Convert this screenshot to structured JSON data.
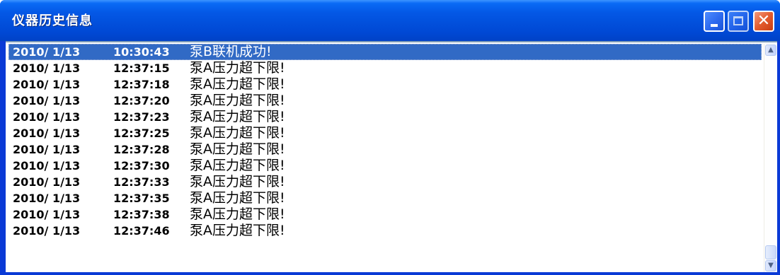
{
  "window": {
    "title": "仪器历史信息",
    "controls": {
      "minimize": "minimize",
      "maximize": "maximize",
      "close": "✕"
    }
  },
  "colors": {
    "titlebar": "#0458e6",
    "selection": "#316ac5",
    "close_button": "#e35b2e"
  },
  "log": {
    "selected_index": 0,
    "entries": [
      {
        "date": "2010/ 1/13",
        "time": "10:30:43",
        "message": "泵B联机成功!"
      },
      {
        "date": "2010/ 1/13",
        "time": "12:37:15",
        "message": "泵A压力超下限!"
      },
      {
        "date": "2010/ 1/13",
        "time": "12:37:18",
        "message": "泵A压力超下限!"
      },
      {
        "date": "2010/ 1/13",
        "time": "12:37:20",
        "message": "泵A压力超下限!"
      },
      {
        "date": "2010/ 1/13",
        "time": "12:37:23",
        "message": "泵A压力超下限!"
      },
      {
        "date": "2010/ 1/13",
        "time": "12:37:25",
        "message": "泵A压力超下限!"
      },
      {
        "date": "2010/ 1/13",
        "time": "12:37:28",
        "message": "泵A压力超下限!"
      },
      {
        "date": "2010/ 1/13",
        "time": "12:37:30",
        "message": "泵A压力超下限!"
      },
      {
        "date": "2010/ 1/13",
        "time": "12:37:33",
        "message": "泵A压力超下限!"
      },
      {
        "date": "2010/ 1/13",
        "time": "12:37:35",
        "message": "泵A压力超下限!"
      },
      {
        "date": "2010/ 1/13",
        "time": "12:37:38",
        "message": "泵A压力超下限!"
      },
      {
        "date": "2010/ 1/13",
        "time": "12:37:46",
        "message": "泵A压力超下限!"
      }
    ]
  },
  "scrollbar": {
    "up_icon": "▲",
    "down_icon": "▼"
  }
}
